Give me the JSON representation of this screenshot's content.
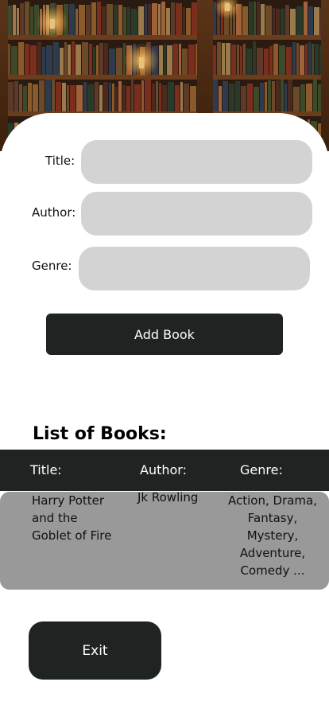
{
  "form": {
    "title_label": "Title:",
    "author_label": "Author:",
    "genre_label": "Genre:",
    "title_value": "",
    "author_value": "",
    "genre_value": "",
    "add_button_label": "Add Book"
  },
  "books": {
    "heading": "List of Books:",
    "columns": [
      "Title:",
      "Author:",
      "Genre:"
    ],
    "rows": [
      {
        "title": "Harry Potter and the Goblet of Fire",
        "author": "Jk Rowling",
        "genre": "Action, Drama, Fantasy, Mystery, Adventure, Comedy ..."
      }
    ]
  },
  "exit_button_label": "Exit",
  "colors": {
    "dark": "#1f2322",
    "input_bg": "#d3d3d3",
    "row_bg": "#999999"
  },
  "header_image": "library-bookshelf-image"
}
